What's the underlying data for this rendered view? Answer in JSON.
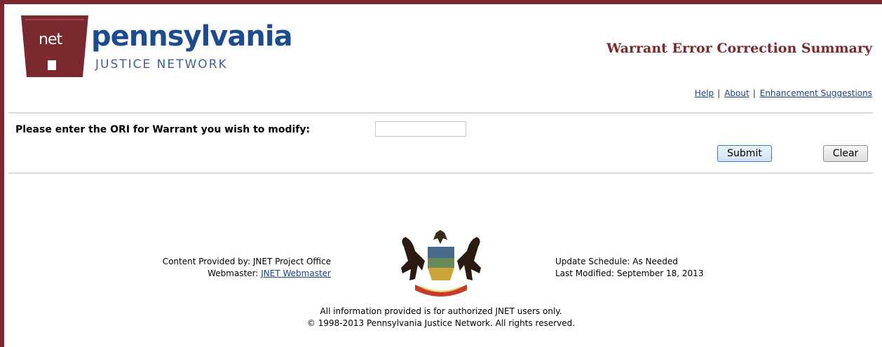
{
  "logo": {
    "mark_text": "net",
    "state_text": "pennsylvania",
    "network_text": "JUSTICE NETWORK"
  },
  "header": {
    "title": "Warrant Error Correction Summary"
  },
  "nav": {
    "help": "Help",
    "about": "About",
    "enhancement": "Enhancement Suggestions",
    "separator": "|"
  },
  "form": {
    "prompt": "Please enter the ORI for Warrant you wish to modify:",
    "ori_value": "",
    "submit_label": "Submit",
    "clear_label": "Clear"
  },
  "footer": {
    "content_provided": "Content Provided by: JNET Project Office",
    "webmaster_label": "Webmaster:",
    "webmaster_link": "JNET Webmaster",
    "update_schedule": "Update Schedule: As Needed",
    "last_modified": "Last Modified: September 18, 2013",
    "notice": "All information provided is for authorized JNET users only.",
    "copyright": "© 1998-2013 Pennsylvania Justice Network. All rights reserved."
  },
  "colors": {
    "brand_maroon": "#7a2a2e",
    "brand_blue": "#1d4b8f",
    "link_blue": "#1d3f8f"
  },
  "icons": {
    "logo": "jnet-keystone-logo",
    "seal": "pennsylvania-state-seal"
  }
}
